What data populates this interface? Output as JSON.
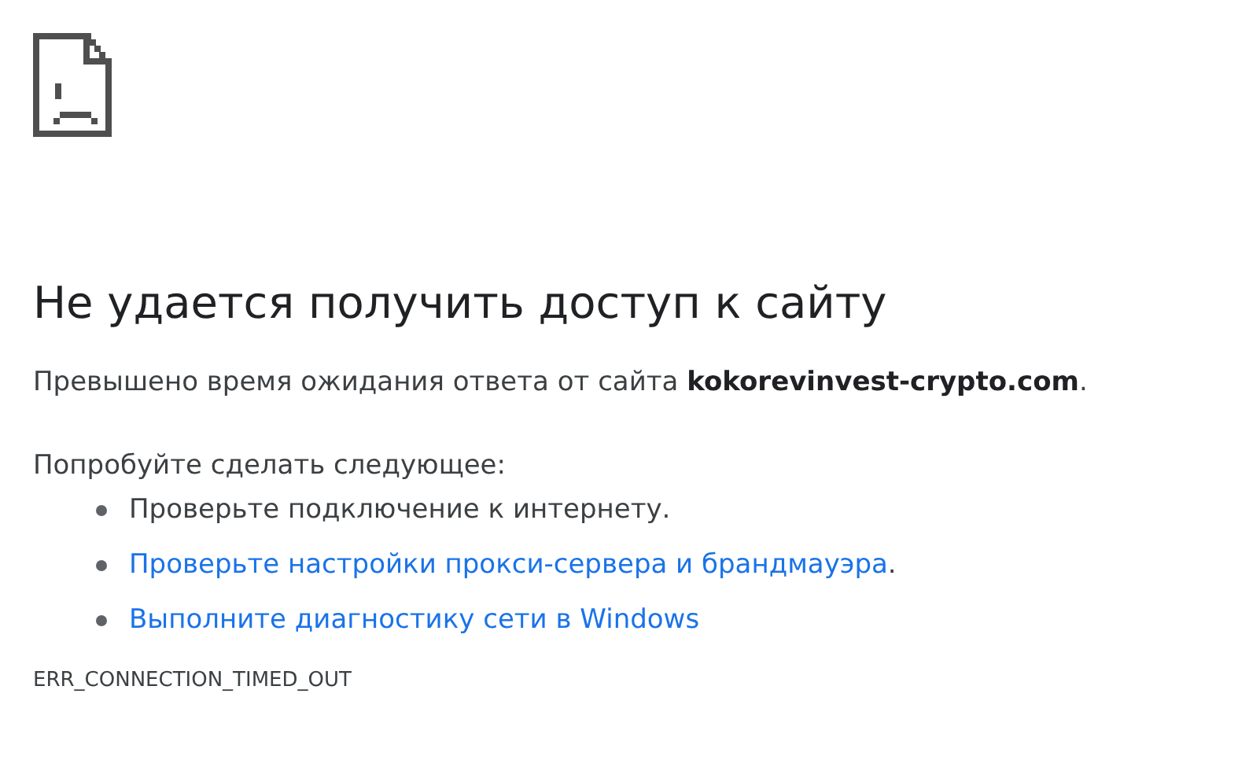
{
  "heading": "Не удается получить доступ к сайту",
  "description": "Превышено время ожидания ответа от сайта **kokorevinvest-crypto.com**.",
  "suggestions_title": "Попробуйте сделать следующее:",
  "suggestions": [
    {
      "kind": "text",
      "text": "Проверьте подключение к интернету."
    },
    {
      "kind": "link",
      "text": "Проверьте настройки прокси-сервера и брандмауэра",
      "suffix": "."
    },
    {
      "kind": "link",
      "text": "Выполните диагностику сети в Windows"
    }
  ],
  "error_code": "ERR_CONNECTION_TIMED_OUT"
}
